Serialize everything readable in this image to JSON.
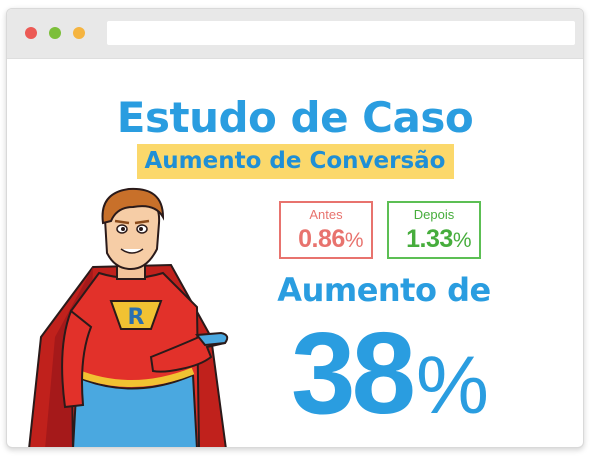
{
  "browser": {
    "controls": [
      "close",
      "minimize",
      "maximize"
    ],
    "controls_colors": {
      "close": "#ec5a55",
      "minimize": "#7cbf3a",
      "maximize": "#f5b440"
    }
  },
  "page": {
    "title": "Estudo de Caso",
    "subtitle": "Aumento de Conversão",
    "before": {
      "label": "Antes",
      "value": "0.86",
      "unit": "%"
    },
    "after": {
      "label": "Depois",
      "value": "1.33",
      "unit": "%"
    },
    "increase_label": "Aumento de",
    "increase_value": "38",
    "increase_unit": "%",
    "mascot": {
      "emblem_letter": "R"
    }
  },
  "colors": {
    "accent_blue": "#2a9de0",
    "highlight_yellow": "#fbd86b",
    "before_red": "#e8736e",
    "after_green": "#46ad3c",
    "hero_suit_red": "#e2312a",
    "hero_suit_blue": "#4aa8e0"
  },
  "icons": [
    "browser-close-dot",
    "browser-minimize-dot",
    "browser-maximize-dot",
    "superhero-mascot"
  ]
}
